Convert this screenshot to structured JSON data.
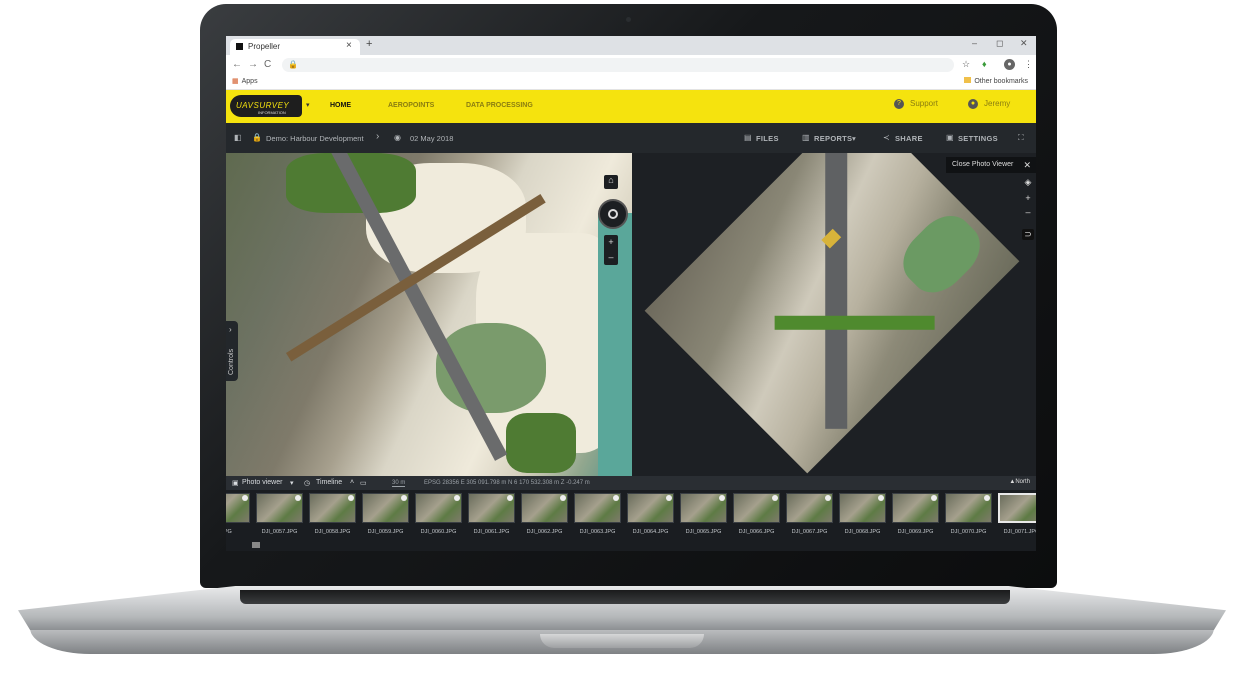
{
  "browser": {
    "tab_title": "Propeller",
    "tab_close": "×",
    "new_tab": "+",
    "win_min": "–",
    "win_max": "◻",
    "win_close": "✕",
    "back": "←",
    "forward": "→",
    "reload": "C",
    "bookmarks": {
      "apps": "Apps",
      "other": "Other bookmarks"
    }
  },
  "app": {
    "logo_text": "UAVSURVEY",
    "logo_sub": "INFORMATION",
    "nav": [
      "HOME",
      "AEROPOINTS",
      "DATA PROCESSING"
    ],
    "support": "Support",
    "user": "Jeremy"
  },
  "project": {
    "name": "Demo: Harbour Development",
    "separator": "›",
    "date": "02 May 2018",
    "actions": {
      "files": "FILES",
      "reports": "REPORTS",
      "reports_caret": "▾",
      "share": "SHARE",
      "settings": "SETTINGS"
    }
  },
  "map": {
    "controls_label": "Controls",
    "zoom_in": "+",
    "zoom_out": "–"
  },
  "viewer": {
    "close_label": "Close Photo Viewer",
    "close_x": "✕"
  },
  "photobar": {
    "photo_viewer": "Photo viewer",
    "timeline": "Timeline",
    "scale": "30 m",
    "coords": "EPSG 28356  E 305 091.798 m  N 6 170 532.308 m  Z -0.247 m",
    "north": "▲North"
  },
  "thumbnails": [
    {
      "label": "JPG"
    },
    {
      "label": "DJI_0057.JPG"
    },
    {
      "label": "DJI_0058.JPG"
    },
    {
      "label": "DJI_0059.JPG"
    },
    {
      "label": "DJI_0060.JPG"
    },
    {
      "label": "DJI_0061.JPG"
    },
    {
      "label": "DJI_0062.JPG"
    },
    {
      "label": "DJI_0063.JPG"
    },
    {
      "label": "DJI_0064.JPG"
    },
    {
      "label": "DJI_0065.JPG"
    },
    {
      "label": "DJI_0066.JPG"
    },
    {
      "label": "DJI_0067.JPG"
    },
    {
      "label": "DJI_0068.JPG"
    },
    {
      "label": "DJI_0069.JPG"
    },
    {
      "label": "DJI_0070.JPG"
    },
    {
      "label": "DJI_0071.JPG"
    }
  ],
  "selected_thumbnail": "DJI_0071.JPG",
  "colors": {
    "brand_yellow": "#f5e30e",
    "app_dark": "#24282c"
  }
}
